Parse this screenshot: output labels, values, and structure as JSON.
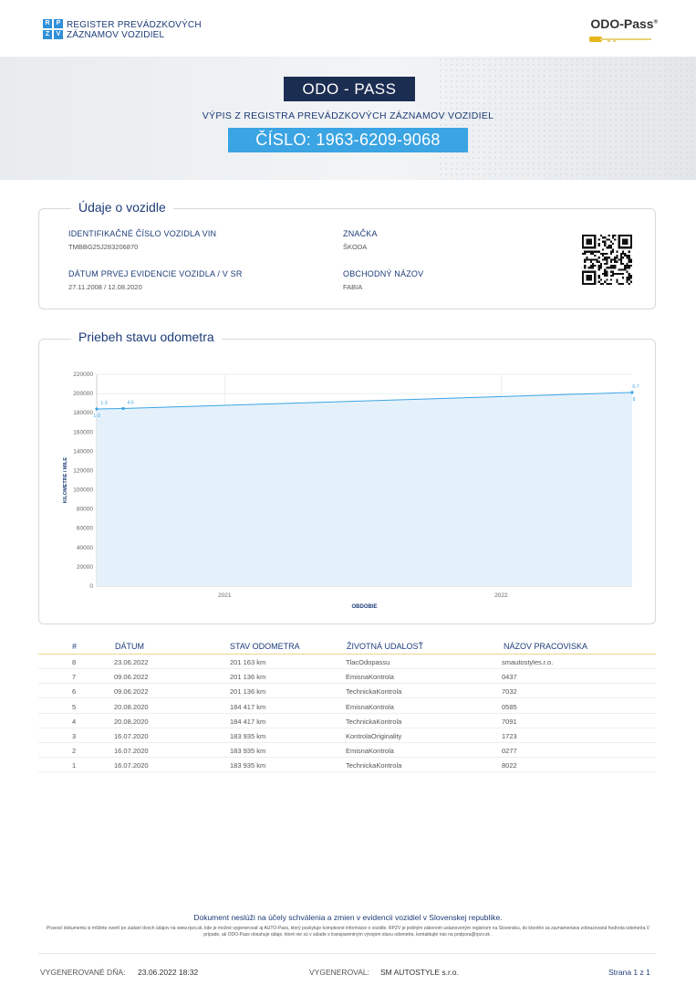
{
  "header": {
    "logo_letters": [
      "R",
      "P",
      "Z",
      "V"
    ],
    "registry_line1": "REGISTER PREVÁDZKOVÝCH",
    "registry_line2": "ZÁZNAMOV VOZIDIEL",
    "brand": "ODO-Pass",
    "brand_mark": "®"
  },
  "banner": {
    "title": "ODO - PASS",
    "subtitle": "VÝPIS Z REGISTRA PREVÁDZKOVÝCH ZÁZNAMOV VOZIDIEL",
    "number": "ČÍSLO: 1963-6209-9068"
  },
  "vehicle": {
    "section_title": "Údaje o vozidle",
    "vin_label": "IDENTIFIKAČNÉ ČÍSLO VOZIDLA VIN",
    "vin": "TMBBG25J283206870",
    "brand_label": "ZNAČKA",
    "brand": "ŠKODA",
    "first_reg_label": "DÁTUM PRVEJ EVIDENCIE VOZIDLA / V SR",
    "first_reg": "27.11.2008 / 12.08.2020",
    "trade_name_label": "OBCHODNÝ NÁZOV",
    "trade_name": "FABIA"
  },
  "chart_section": {
    "title": "Priebeh stavu odometra"
  },
  "chart_data": {
    "type": "area",
    "ylabel": "KILOMETRE / MILE",
    "xlabel": "OBDOBIE",
    "ylim": [
      0,
      220000
    ],
    "yticks": [
      0,
      20000,
      40000,
      60000,
      80000,
      100000,
      120000,
      140000,
      160000,
      180000,
      200000,
      220000
    ],
    "xticks": [
      "2021",
      "2022"
    ],
    "x": [
      "2020-07-16",
      "2020-08-20",
      "2022-06-23"
    ],
    "values": [
      183935,
      184417,
      201163
    ],
    "point_labels": [
      {
        "date": "2020-07-16",
        "value": 183935,
        "label_above": "1-3",
        "label_below": "1-3"
      },
      {
        "date": "2020-08-20",
        "value": 184417,
        "label_above": "4-5",
        "label_below": ""
      },
      {
        "date": "2022-06-23",
        "value": 201163,
        "label_above": "6-7",
        "label_below": "8"
      }
    ],
    "grid": true,
    "color": "#3ba4e3"
  },
  "table": {
    "headers": [
      "#",
      "DÁTUM",
      "STAV ODOMETRA",
      "ŽIVOTNÁ UDALOSŤ",
      "NÁZOV PRACOVISKA"
    ],
    "rows": [
      [
        "8",
        "23.06.2022",
        "201 163 km",
        "TlacOdopassu",
        "smautostyles.r.o."
      ],
      [
        "7",
        "09.06.2022",
        "201 136 km",
        "EmisnaKontrola",
        "0437"
      ],
      [
        "6",
        "09.06.2022",
        "201 136 km",
        "TechnickaKontrola",
        "7032"
      ],
      [
        "5",
        "20.08.2020",
        "184 417 km",
        "EmisnaKontrola",
        "0585"
      ],
      [
        "4",
        "20.08.2020",
        "184 417 km",
        "TechnickaKontrola",
        "7091"
      ],
      [
        "3",
        "16.07.2020",
        "183 935 km",
        "KontrolaOriginality",
        "1723"
      ],
      [
        "2",
        "16.07.2020",
        "183 935 km",
        "EmisnaKontrola",
        "0277"
      ],
      [
        "1",
        "16.07.2020",
        "183 935 km",
        "TechnickaKontrola",
        "8022"
      ]
    ]
  },
  "footer": {
    "notice": "Dokument neslúži na účely schválenia a zmien v evidencii vozidiel v Slovenskej republike.",
    "fine_print": "Pravosť dokumentu si môžete overiť po zadaní dvoch údajov na www.rpzv.sk, kde je možné vygenerovať aj AUTO-Pass, ktorý poskytuje komplexné informácie o vozidle. RPZV je jediným zákonom ustanoveným registrom na Slovensku, do ktorého sa zaznamenáva zobrazovaná hodnota odometra.V prípade, ak ODO-Pass obsahuje údaje, ktoré nie sú v súlade s transparentným vývojom stavu odometra, kontaktujte nás na podpora@rpzv.sk .",
    "generated_label": "VYGENEROVANÉ DŇA:",
    "generated_value": "23.06.2022 18:32",
    "generated_by_label": "VYGENEROVAL:",
    "generated_by_value": "SM AUTOSTYLE s.r.o.",
    "page": "Strana 1 z 1"
  }
}
